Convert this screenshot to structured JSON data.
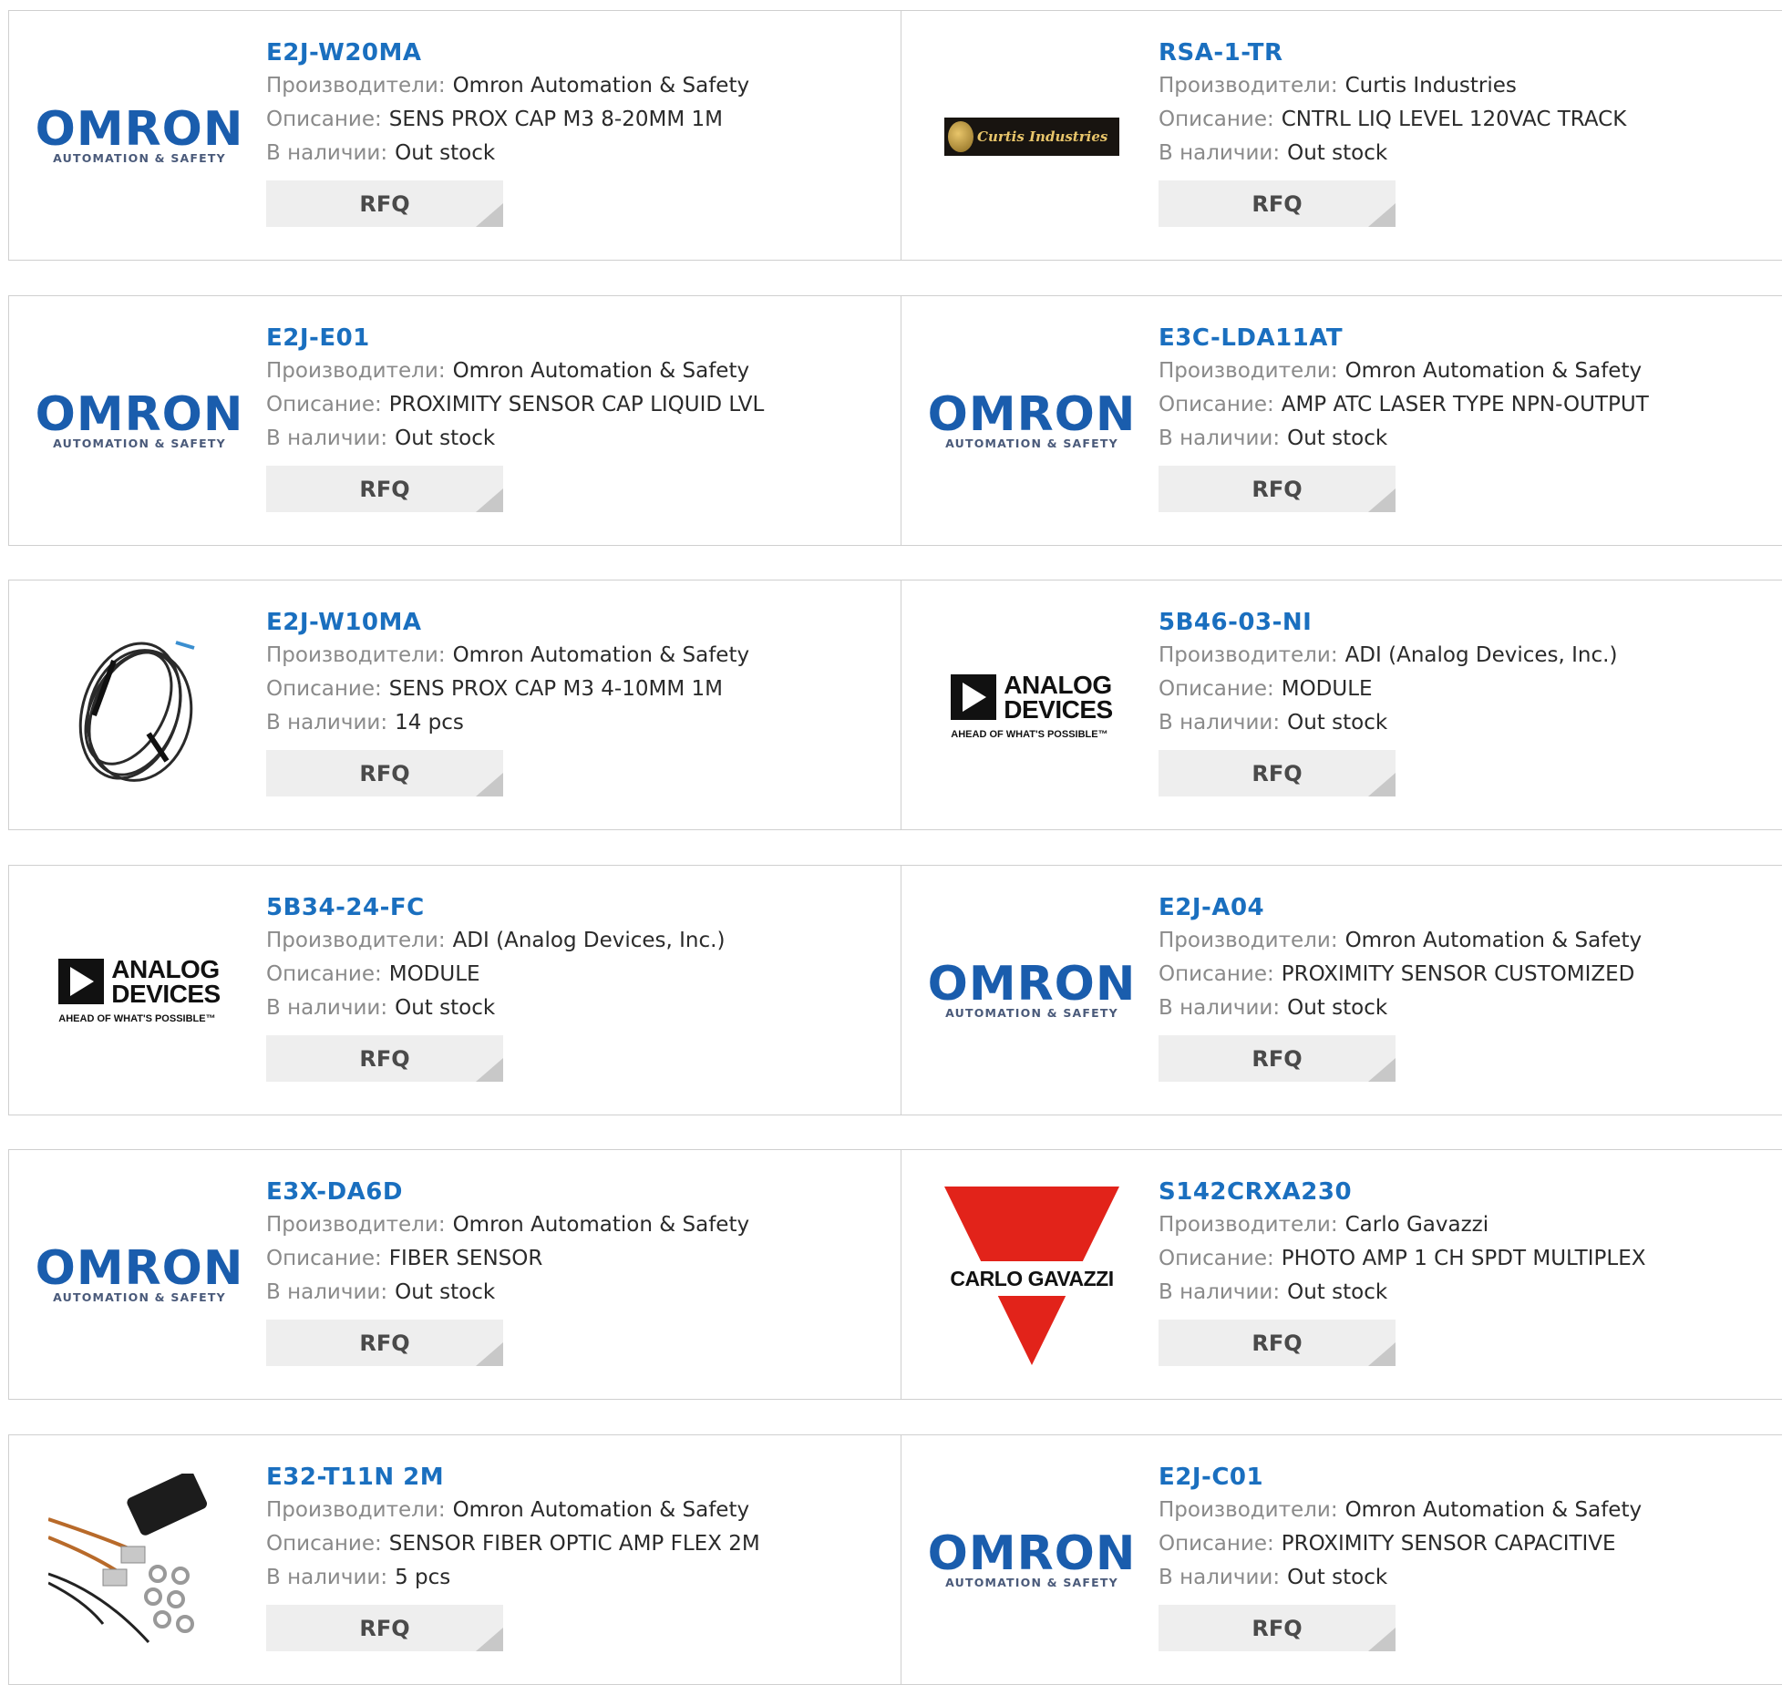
{
  "labels": {
    "manufacturer": "Производители:",
    "description": "Описание:",
    "stock": "В наличии:",
    "rfq": "RFQ"
  },
  "logos": {
    "omron_main": "OMRON",
    "omron_sub": "AUTOMATION & SAFETY",
    "adi_line1": "ANALOG",
    "adi_line2": "DEVICES",
    "adi_tag": "AHEAD OF WHAT'S POSSIBLE™",
    "curtis": "Curtis Industries",
    "carlo": "CARLO GAVAZZI"
  },
  "colors": {
    "link": "#1a6fbf",
    "omron": "#1a5dad",
    "carlo_red": "#e2231a",
    "button_bg": "#eeeeee"
  },
  "products": [
    {
      "part": "E2J-W20MA",
      "manufacturer": "Omron Automation & Safety",
      "description": "SENS PROX CAP M3 8-20MM 1M",
      "stock": "Out stock",
      "logo": "omron-logo"
    },
    {
      "part": "RSA-1-TR",
      "manufacturer": "Curtis Industries",
      "description": "CNTRL LIQ LEVEL 120VAC TRACK",
      "stock": "Out stock",
      "logo": "curtis-logo"
    },
    {
      "part": "E2J-E01",
      "manufacturer": "Omron Automation & Safety",
      "description": "PROXIMITY SENSOR CAP LIQUID LVL",
      "stock": "Out stock",
      "logo": "omron-logo"
    },
    {
      "part": "E3C-LDA11AT",
      "manufacturer": "Omron Automation & Safety",
      "description": "AMP ATC LASER TYPE NPN-OUTPUT",
      "stock": "Out stock",
      "logo": "omron-logo"
    },
    {
      "part": "E2J-W10MA",
      "manufacturer": "Omron Automation & Safety",
      "description": "SENS PROX CAP M3 4-10MM 1M",
      "stock": "14 pcs",
      "logo": "cable-photo"
    },
    {
      "part": "5B46-03-NI",
      "manufacturer": "ADI (Analog Devices, Inc.)",
      "description": "MODULE",
      "stock": "Out stock",
      "logo": "analog-devices-logo"
    },
    {
      "part": "5B34-24-FC",
      "manufacturer": "ADI (Analog Devices, Inc.)",
      "description": "MODULE",
      "stock": "Out stock",
      "logo": "analog-devices-logo"
    },
    {
      "part": "E2J-A04",
      "manufacturer": "Omron Automation & Safety",
      "description": "PROXIMITY SENSOR CUSTOMIZED",
      "stock": "Out stock",
      "logo": "omron-logo"
    },
    {
      "part": "E3X-DA6D",
      "manufacturer": "Omron Automation & Safety",
      "description": "FIBER SENSOR",
      "stock": "Out stock",
      "logo": "omron-logo"
    },
    {
      "part": "S142CRXA230",
      "manufacturer": "Carlo Gavazzi",
      "description": "PHOTO AMP 1 CH SPDT MULTIPLEX",
      "stock": "Out stock",
      "logo": "carlo-gavazzi-logo"
    },
    {
      "part": "E32-T11N 2M",
      "manufacturer": "Omron Automation & Safety",
      "description": "SENSOR FIBER OPTIC AMP FLEX 2M",
      "stock": "5 pcs",
      "logo": "fiber-amp-photo"
    },
    {
      "part": "E2J-C01",
      "manufacturer": "Omron Automation & Safety",
      "description": "PROXIMITY SENSOR CAPACITIVE",
      "stock": "Out stock",
      "logo": "omron-logo"
    }
  ]
}
